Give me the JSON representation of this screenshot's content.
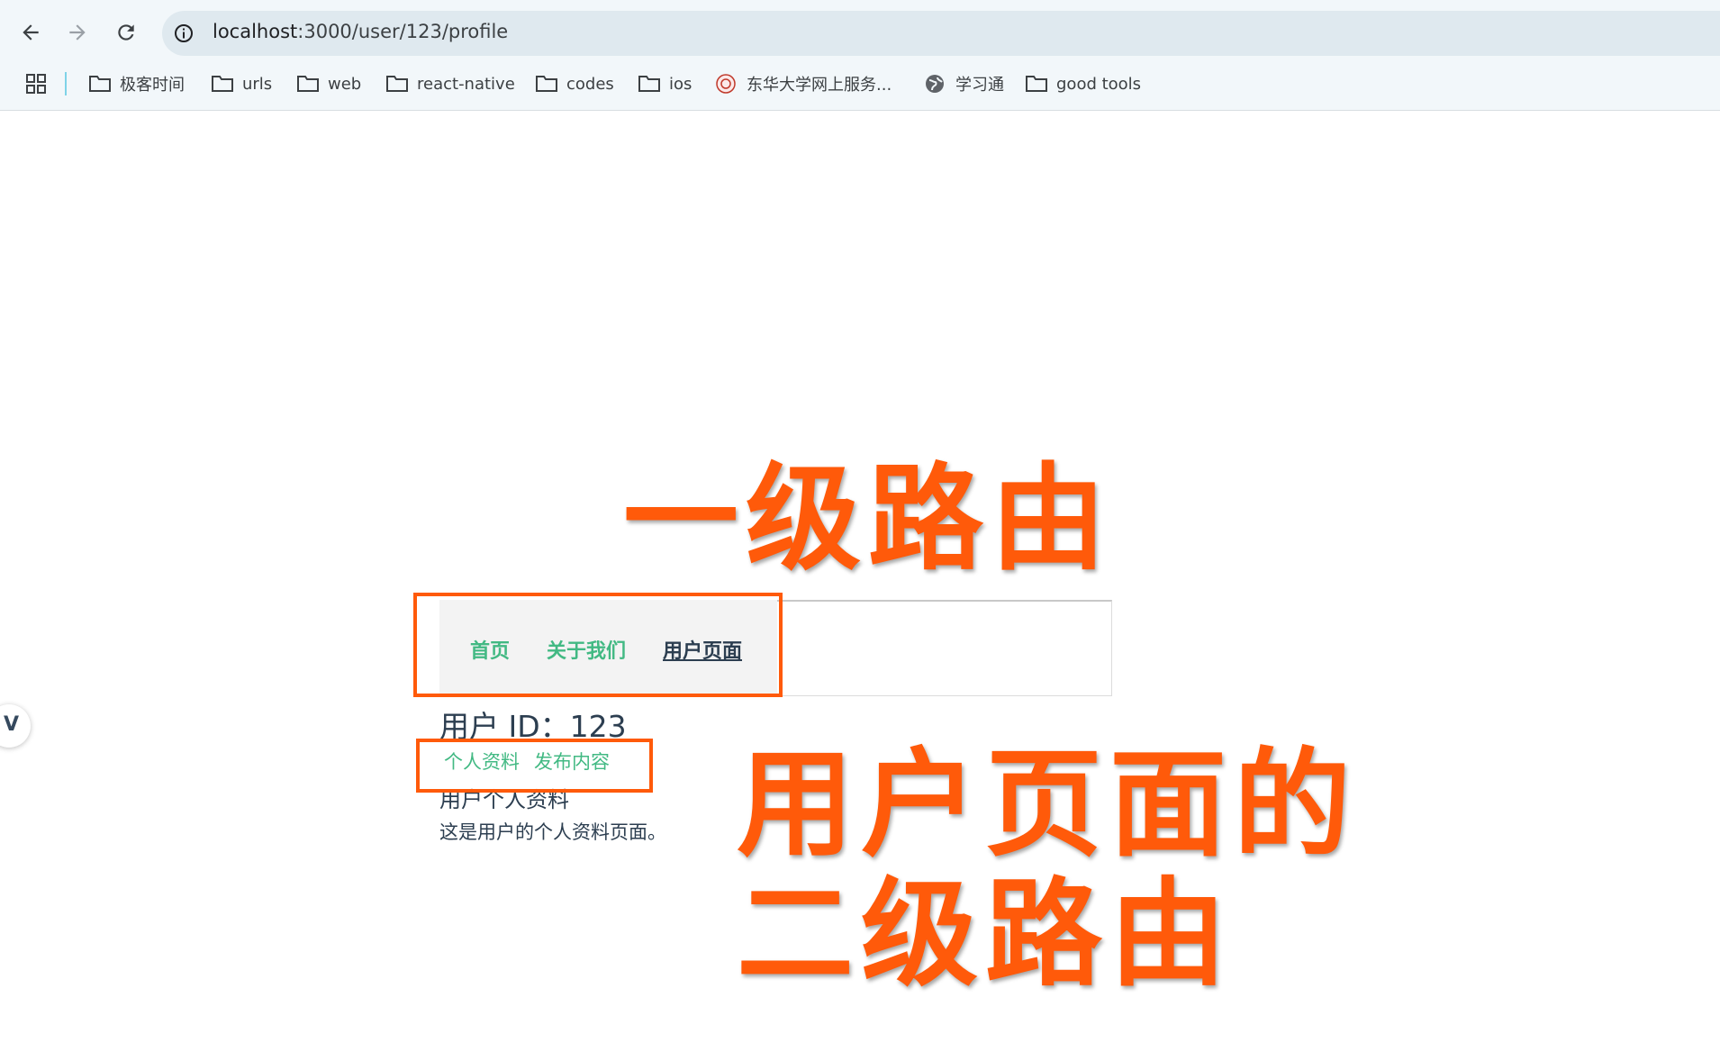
{
  "browser": {
    "url_host": "localhost",
    "url_path": ":3000/user/123/profile",
    "bookmarks": [
      {
        "label": "极客时间",
        "icon": "folder-icon"
      },
      {
        "label": "urls",
        "icon": "folder-icon"
      },
      {
        "label": "web",
        "icon": "folder-icon"
      },
      {
        "label": "react-native",
        "icon": "folder-icon"
      },
      {
        "label": "codes",
        "icon": "folder-icon"
      },
      {
        "label": "ios",
        "icon": "folder-icon"
      },
      {
        "label": "东华大学网上服务...",
        "icon": "university-seal-icon"
      },
      {
        "label": "学习通",
        "icon": "globe-icon"
      },
      {
        "label": "good tools",
        "icon": "folder-icon"
      }
    ]
  },
  "app": {
    "nav": {
      "home": "首页",
      "about": "关于我们",
      "user": "用户页面"
    },
    "user_id_line": "用户 ID：123",
    "subnav": {
      "profile": "个人资料",
      "posts": "发布内容"
    },
    "profile_title": "用户个人资料",
    "profile_text": "这是用户的个人资料页面。"
  },
  "annotations": {
    "first_level": "一级路由",
    "second_level_line1": "用户页面的",
    "second_level_line2": "二级路由"
  },
  "colors": {
    "accent": "#42b983",
    "annotation": "#ff5a0a",
    "text_dark": "#2c3e50"
  }
}
